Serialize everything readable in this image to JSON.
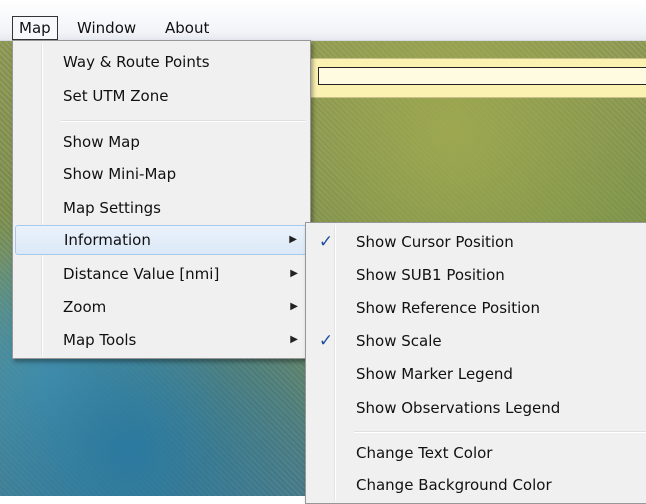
{
  "menubar": {
    "items": [
      {
        "label": "Map",
        "active": true
      },
      {
        "label": "Window",
        "active": false
      },
      {
        "label": "About",
        "active": false
      }
    ]
  },
  "map_menu": {
    "items": [
      {
        "label": "Way & Route Points"
      },
      {
        "label": "Set UTM Zone"
      },
      {
        "label": "Show Map"
      },
      {
        "label": "Show Mini-Map"
      },
      {
        "label": "Map Settings"
      },
      {
        "label": "Information",
        "submenu": true,
        "highlighted": true
      },
      {
        "label": "Distance Value [nmi]",
        "submenu": true
      },
      {
        "label": "Zoom",
        "submenu": true
      },
      {
        "label": "Map Tools",
        "submenu": true
      }
    ]
  },
  "information_submenu": {
    "items": [
      {
        "label": "Show Cursor Position",
        "checked": true
      },
      {
        "label": "Show SUB1 Position",
        "checked": false
      },
      {
        "label": "Show Reference Position",
        "checked": false
      },
      {
        "label": "Show Scale",
        "checked": true
      },
      {
        "label": "Show Marker Legend",
        "checked": false
      },
      {
        "label": "Show Observations Legend",
        "checked": false
      },
      {
        "label": "Change Text Color",
        "checked": false
      },
      {
        "label": "Change Background Color",
        "checked": false
      }
    ]
  },
  "icons": {
    "check": "✓",
    "submenu_arrow": "▶"
  },
  "colors": {
    "menu_bg": "#f0f0f0",
    "highlight_bg": "#dbe8f7",
    "highlight_border": "#a8c8eb",
    "check_color": "#1f4fa0",
    "map_info_bar": "#fbf2b2"
  }
}
